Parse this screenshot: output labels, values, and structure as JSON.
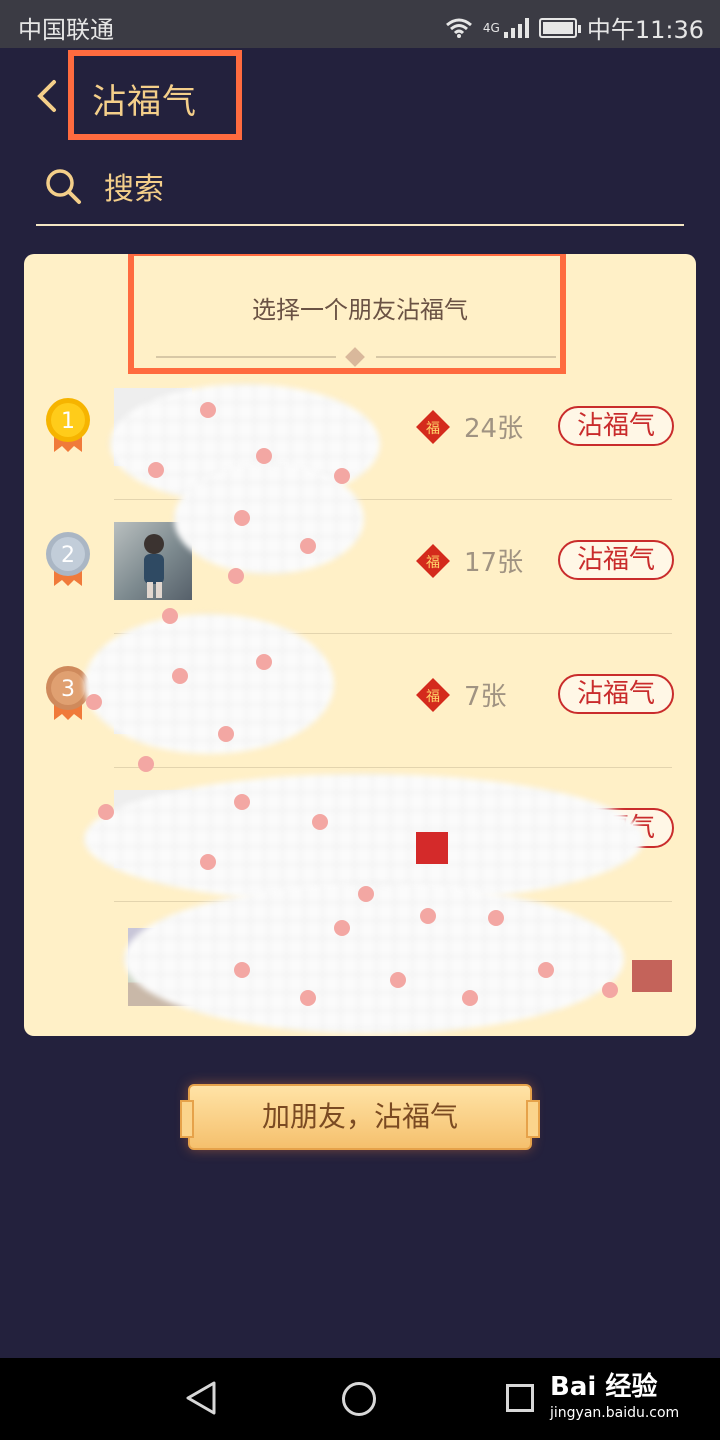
{
  "status_bar": {
    "carrier": "中国联通",
    "network": "4G",
    "time": "中午11:36"
  },
  "header": {
    "title": "沾福气",
    "search_label": "搜索"
  },
  "card": {
    "title": "选择一个朋友沾福气",
    "rows": [
      {
        "rank": "1",
        "count": "24张",
        "action": "沾福气"
      },
      {
        "rank": "2",
        "count": "17张",
        "action": "沾福气"
      },
      {
        "rank": "3",
        "count": "7张",
        "action": "沾福气"
      },
      {
        "action": "沾福气"
      }
    ]
  },
  "fu_char": "福",
  "footer": {
    "add_friend_button": "加朋友，沾福气"
  },
  "watermark": {
    "brand": "Bai 经验",
    "url": "jingyan.baidu.com"
  },
  "colors": {
    "background": "#23213d",
    "card": "#fff0c7",
    "accent": "#c92c2c",
    "title": "#f4cf8a",
    "highlight_box": "#ff6b3f"
  }
}
